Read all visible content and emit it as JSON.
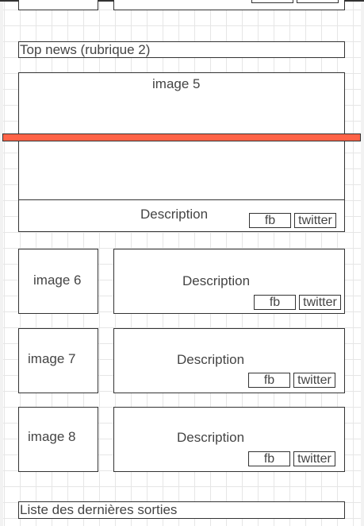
{
  "sections": {
    "top_news_title": "Top news (rubrique 2)",
    "latest_title": "Liste des dernières sorties"
  },
  "featured": {
    "image_label": "image 5",
    "description": "Description",
    "fb": "fb",
    "twitter": "twitter"
  },
  "articles": [
    {
      "image_label": "image 6",
      "description": "Description",
      "fb": "fb",
      "twitter": "twitter"
    },
    {
      "image_label": "image 7",
      "description": "Description",
      "fb": "fb",
      "twitter": "twitter"
    },
    {
      "image_label": "image 8",
      "description": "Description",
      "fb": "fb",
      "twitter": "twitter"
    }
  ],
  "colors": {
    "divider_bar": "#ff6347",
    "stroke": "#333333"
  }
}
